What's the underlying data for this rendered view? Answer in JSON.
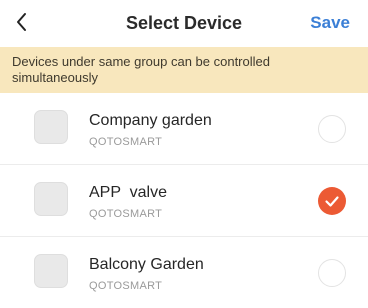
{
  "header": {
    "back_icon": "chevron-left-icon",
    "title": "Select Device",
    "save_label": "Save",
    "save_color": "#3b7fd6"
  },
  "notice": {
    "text": "Devices under same group can be controlled simultaneously",
    "background": "#f8e7bd"
  },
  "devices": [
    {
      "name": "Company garden",
      "brand": "QOTOSMART",
      "selected": false
    },
    {
      "name": "APP  valve",
      "brand": "QOTOSMART",
      "selected": true
    },
    {
      "name": "Balcony Garden",
      "brand": "QOTOSMART",
      "selected": false
    }
  ],
  "colors": {
    "selected": "#ec5a34"
  }
}
